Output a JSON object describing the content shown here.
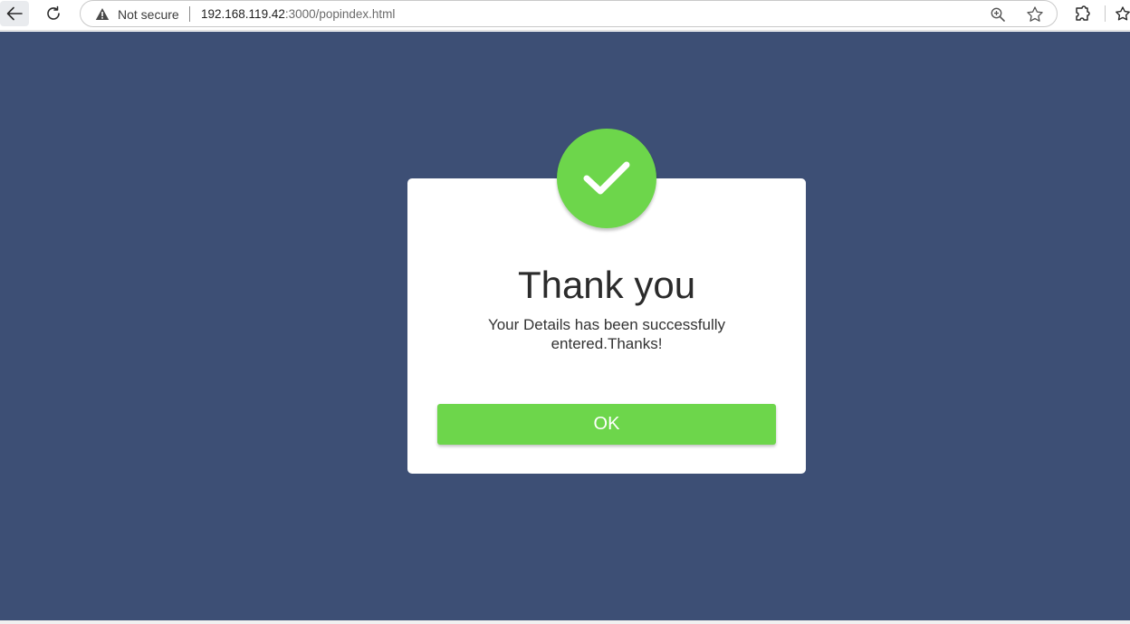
{
  "browser": {
    "security_label": "Not secure",
    "url_host": "192.168.119.42",
    "url_rest": ":3000/popindex.html",
    "icons": [
      "back-arrow-icon",
      "reload-icon",
      "warning-icon",
      "zoom-icon",
      "star-icon",
      "extensions-icon",
      "favorites-icon"
    ]
  },
  "page": {
    "background_color": "#3d4f75"
  },
  "modal": {
    "title": "Thank you",
    "message": "Your Details has been successfully entered.Thanks!",
    "ok_label": "OK",
    "icon": "checkmark-icon",
    "accent_color": "#6dd64b"
  }
}
